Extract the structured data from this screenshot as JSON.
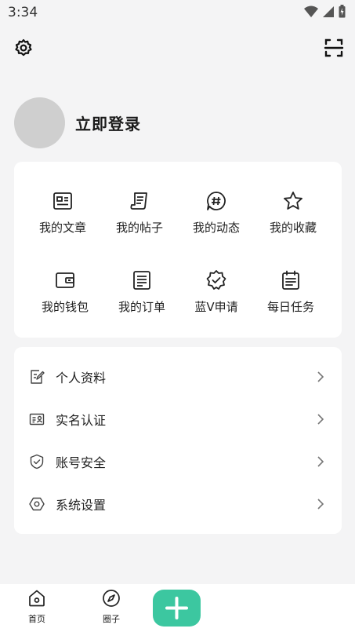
{
  "status_bar": {
    "time": "3:34"
  },
  "profile": {
    "login_text": "立即登录"
  },
  "grid": [
    {
      "label": "我的文章",
      "icon": "article-icon"
    },
    {
      "label": "我的帖子",
      "icon": "post-icon"
    },
    {
      "label": "我的动态",
      "icon": "hashtag-icon"
    },
    {
      "label": "我的收藏",
      "icon": "star-icon"
    },
    {
      "label": "我的钱包",
      "icon": "wallet-icon"
    },
    {
      "label": "我的订单",
      "icon": "order-icon"
    },
    {
      "label": "蓝V申请",
      "icon": "verified-badge-icon"
    },
    {
      "label": "每日任务",
      "icon": "calendar-task-icon"
    }
  ],
  "list": [
    {
      "label": "个人资料",
      "icon": "edit-profile-icon"
    },
    {
      "label": "实名认证",
      "icon": "id-card-icon"
    },
    {
      "label": "账号安全",
      "icon": "shield-icon"
    },
    {
      "label": "系统设置",
      "icon": "hexagon-settings-icon"
    }
  ],
  "tabbar": {
    "home_label": "首页",
    "circle_label": "圈子"
  },
  "colors": {
    "accent": "#3cc7a0",
    "background": "#f4f4f5",
    "card": "#ffffff"
  }
}
